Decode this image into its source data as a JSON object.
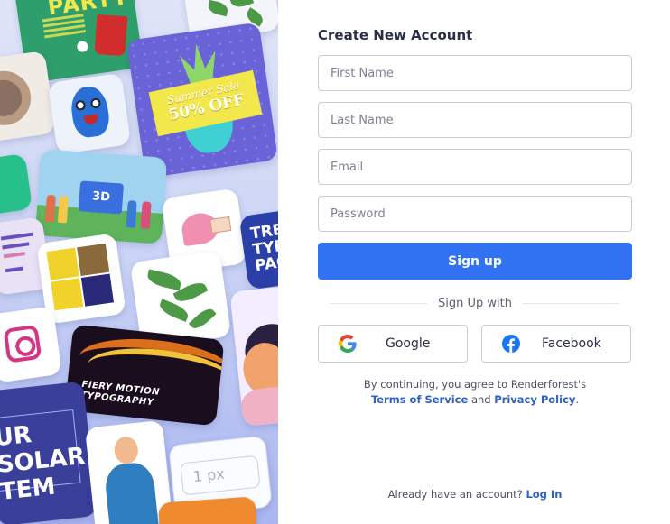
{
  "form": {
    "title": "Create New Account",
    "first_name": {
      "placeholder": "First Name",
      "value": ""
    },
    "last_name": {
      "placeholder": "Last Name",
      "value": ""
    },
    "email": {
      "placeholder": "Email",
      "value": ""
    },
    "password": {
      "placeholder": "Password",
      "value": ""
    },
    "signup_label": "Sign up"
  },
  "social": {
    "divider_label": "Sign Up with",
    "google": {
      "label": "Google",
      "icon": "google-icon"
    },
    "facebook": {
      "label": "Facebook",
      "icon": "facebook-icon",
      "color": "#1877f2"
    }
  },
  "terms": {
    "prefix": "By continuing, you agree to Renderforest's",
    "tos_label": "Terms of Service",
    "and": "and",
    "privacy_label": "Privacy Policy",
    "suffix": "."
  },
  "login": {
    "prompt": "Already have an account?",
    "link_label": "Log In"
  },
  "collage": {
    "party_word": "PARTY",
    "sale_line1": "Summer Sale",
    "sale_line2": "50% OFF",
    "kids_label": "3D",
    "typo_word": "TRE TYPO PACK",
    "fiery_text": "FIERY MOTION TYPOGRAPHY",
    "solar_text": "UR SOLAR TEM",
    "px_value": "1 px"
  },
  "colors": {
    "accent": "#3172f3",
    "link": "#2f5ec4",
    "text": "#2b2f45"
  }
}
